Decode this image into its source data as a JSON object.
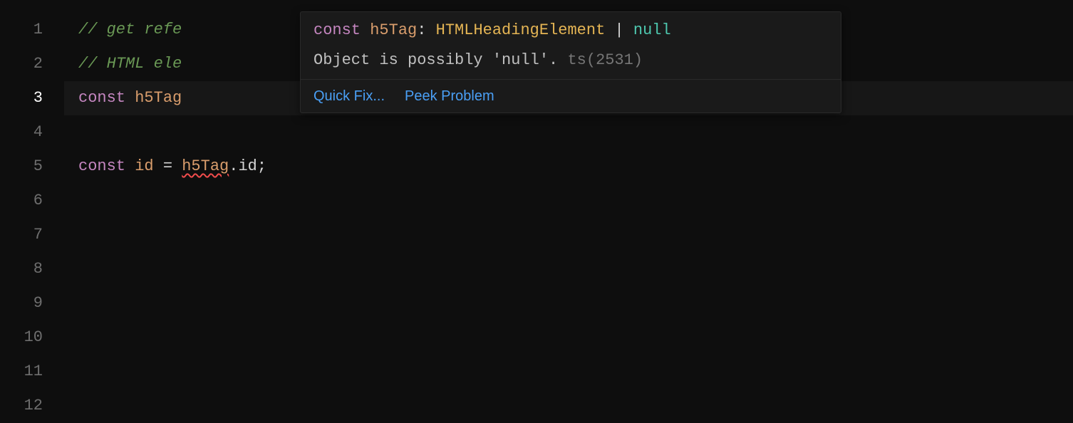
{
  "gutter": {
    "lines": [
      "1",
      "2",
      "3",
      "4",
      "5",
      "6",
      "7",
      "8",
      "9",
      "10",
      "11",
      "12"
    ],
    "current_line_index": 2
  },
  "code": {
    "line1_comment": "// get refe",
    "line2_comment": "// HTML ele",
    "line3_const": "const",
    "line3_ident": "h5Tag",
    "line5_const": "const",
    "line5_id": "id",
    "line5_eq": " = ",
    "line5_h5tag": "h5Tag",
    "line5_dot": ".",
    "line5_prop": "id",
    "line5_semi": ";"
  },
  "hover": {
    "sig_const": "const",
    "sig_space1": " ",
    "sig_ident": "h5Tag",
    "sig_colon": ": ",
    "sig_type": "HTMLHeadingElement",
    "sig_pipe": " | ",
    "sig_null": "null",
    "message_main": "Object is possibly 'null'.",
    "message_code": "ts(2531)",
    "action_quickfix": "Quick Fix...",
    "action_peek": "Peek Problem"
  }
}
